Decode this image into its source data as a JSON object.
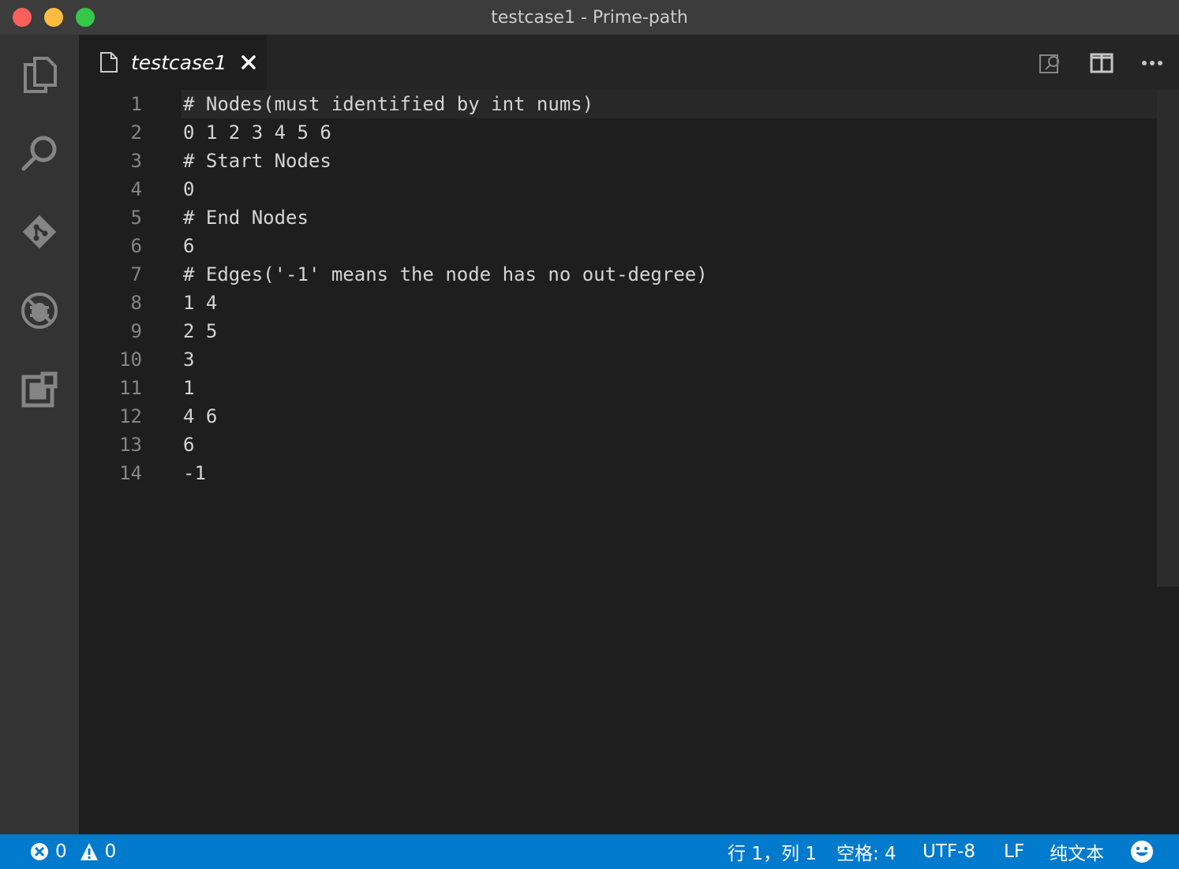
{
  "window": {
    "title": "testcase1 - Prime-path"
  },
  "activity_bar": {
    "items": [
      "explorer-icon",
      "search-icon",
      "source-control-icon",
      "debug-icon",
      "extensions-icon"
    ]
  },
  "tab": {
    "label": "testcase1",
    "close_glyph": "✕"
  },
  "editor_actions": [
    "open-preview-icon",
    "split-editor-icon",
    "more-actions-icon"
  ],
  "editor": {
    "lines": [
      {
        "num": "1",
        "text": "# Nodes(must identified by int nums)"
      },
      {
        "num": "2",
        "text": "0 1 2 3 4 5 6"
      },
      {
        "num": "3",
        "text": "# Start Nodes"
      },
      {
        "num": "4",
        "text": "0"
      },
      {
        "num": "5",
        "text": "# End Nodes"
      },
      {
        "num": "6",
        "text": "6"
      },
      {
        "num": "7",
        "text": "# Edges('-1' means the node has no out-degree)"
      },
      {
        "num": "8",
        "text": "1 4"
      },
      {
        "num": "9",
        "text": "2 5"
      },
      {
        "num": "10",
        "text": "3"
      },
      {
        "num": "11",
        "text": "1"
      },
      {
        "num": "12",
        "text": "4 6"
      },
      {
        "num": "13",
        "text": "6"
      },
      {
        "num": "14",
        "text": "-1"
      }
    ]
  },
  "status_bar": {
    "errors": "0",
    "warnings": "0",
    "cursor_position": "行 1，列 1",
    "indentation": "空格: 4",
    "encoding": "UTF-8",
    "eol": "LF",
    "language": "纯文本"
  }
}
